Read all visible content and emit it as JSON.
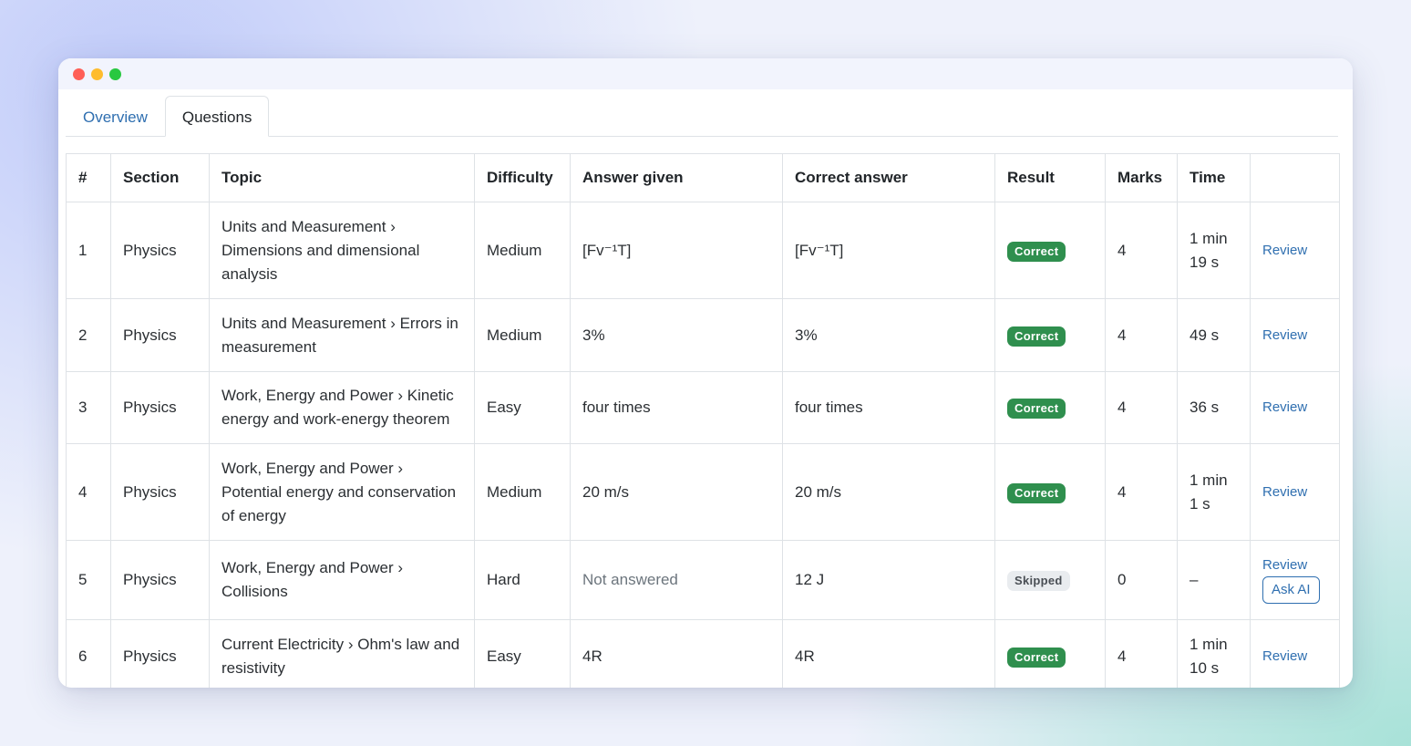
{
  "colors": {
    "accent": "#2f6fb0",
    "correct_badge": "#2f8f4e",
    "skipped_badge": "#e9ecef"
  },
  "tabs": [
    {
      "label": "Overview",
      "active": false
    },
    {
      "label": "Questions",
      "active": true
    }
  ],
  "table": {
    "headers": [
      "#",
      "Section",
      "Topic",
      "Difficulty",
      "Answer given",
      "Correct answer",
      "Result",
      "Marks",
      "Time",
      ""
    ],
    "rows": [
      {
        "num": "1",
        "section": "Physics",
        "topic": "Units and Measurement › Dimensions and dimensional analysis",
        "difficulty": "Medium",
        "answer_given": "[Fv⁻¹T]",
        "correct_answer": "[Fv⁻¹T]",
        "result": "Correct",
        "marks": "4",
        "time": "1 min 19 s",
        "action": "Review"
      },
      {
        "num": "2",
        "section": "Physics",
        "topic": "Units and Measurement › Errors in measurement",
        "difficulty": "Medium",
        "answer_given": "3%",
        "correct_answer": "3%",
        "result": "Correct",
        "marks": "4",
        "time": "49 s",
        "action": "Review"
      },
      {
        "num": "3",
        "section": "Physics",
        "topic": "Work, Energy and Power › Kinetic energy and work-energy theorem",
        "difficulty": "Easy",
        "answer_given": "four times",
        "correct_answer": "four times",
        "result": "Correct",
        "marks": "4",
        "time": "36 s",
        "action": "Review"
      },
      {
        "num": "4",
        "section": "Physics",
        "topic": "Work, Energy and Power › Potential energy and conservation of energy",
        "difficulty": "Medium",
        "answer_given": "20 m/s",
        "correct_answer": "20 m/s",
        "result": "Correct",
        "marks": "4",
        "time": "1 min 1 s",
        "action": "Review"
      },
      {
        "num": "5",
        "section": "Physics",
        "topic": "Work, Energy and Power › Collisions",
        "difficulty": "Hard",
        "answer_given": "Not answered",
        "correct_answer": "12 J",
        "result": "Skipped",
        "marks": "0",
        "time": "–",
        "action": "Review",
        "extra_action": "Ask AI"
      },
      {
        "num": "6",
        "section": "Physics",
        "topic": "Current Electricity › Ohm's law and resistivity",
        "difficulty": "Easy",
        "answer_given": "4R",
        "correct_answer": "4R",
        "result": "Correct",
        "marks": "4",
        "time": "1 min 10 s",
        "action": "Review"
      }
    ]
  }
}
